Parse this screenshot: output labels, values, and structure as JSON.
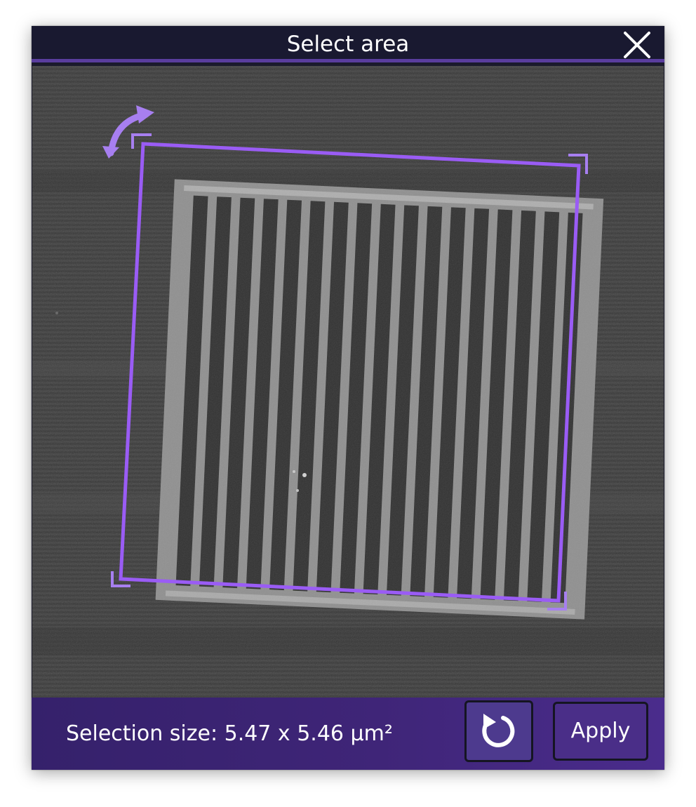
{
  "dialog": {
    "title": "Select area",
    "close_icon": "close-icon"
  },
  "viewport": {
    "image_description_icon": "grating-micrograph",
    "rotate_icon": "rotate-arrow-icon",
    "grating": {
      "bar_count": 17
    }
  },
  "footer": {
    "selection_size": "Selection size: 5.47 x 5.46 µm²",
    "reset_icon": "reset-icon",
    "apply_label": "Apply"
  },
  "colors": {
    "accent": "#9a5cf5",
    "handle": "#a77ff0",
    "titlebar": "#191930",
    "titlebar_border": "#5a3d9e",
    "footer": "#3f2578",
    "background_image": "#3b3b3b"
  }
}
